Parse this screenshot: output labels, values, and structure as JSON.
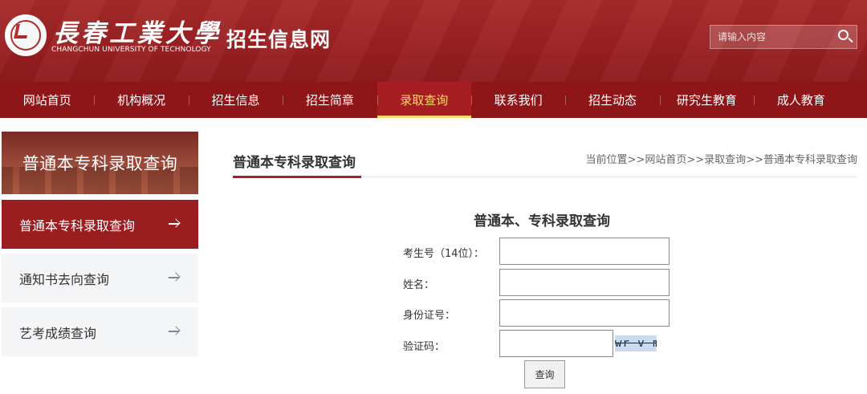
{
  "header": {
    "university_name_cn": "長春工業大學",
    "university_name_en": "CHANGCHUN UNIVERSITY OF TECHNOLOGY",
    "site_title": "招生信息网",
    "search_placeholder": "请输入内容"
  },
  "nav": {
    "items": [
      {
        "label": "网站首页"
      },
      {
        "label": "机构概况"
      },
      {
        "label": "招生信息"
      },
      {
        "label": "招生简章"
      },
      {
        "label": "录取查询"
      },
      {
        "label": "联系我们"
      },
      {
        "label": "招生动态"
      },
      {
        "label": "研究生教育"
      },
      {
        "label": "成人教育"
      }
    ],
    "active": "录取查询"
  },
  "sidebar": {
    "banner_title": "普通本专科录取查询",
    "items": [
      {
        "label": "普通本专科录取查询"
      },
      {
        "label": "通知书去向查询"
      },
      {
        "label": "艺考成绩查询"
      }
    ],
    "active": "普通本专科录取查询"
  },
  "main": {
    "title": "普通本专科录取查询",
    "breadcrumb": {
      "prefix": "当前位置",
      "sep": ">>",
      "items": [
        "网站首页",
        "录取查询",
        "普通本专科录取查询"
      ]
    }
  },
  "form": {
    "title": "普通本、专科录取查询",
    "fields": [
      {
        "label": "考生号（14位）：",
        "value": ""
      },
      {
        "label": "姓名：",
        "value": ""
      },
      {
        "label": "身份证号：",
        "value": ""
      },
      {
        "label": "验证码：",
        "value": ""
      }
    ],
    "captcha_text": "wr v m",
    "submit_label": "查询"
  },
  "colors": {
    "brand_red": "#9a1d20",
    "nav_active_text": "#ffd86b",
    "captcha_bg": "#c9dcf1"
  }
}
